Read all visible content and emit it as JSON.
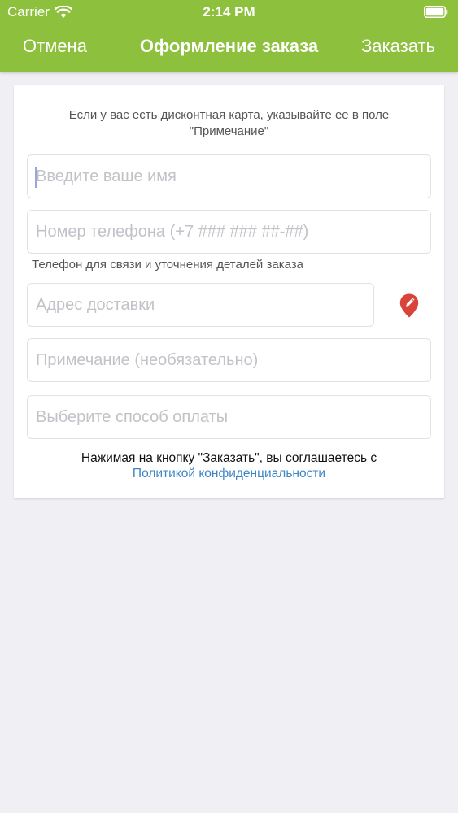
{
  "status_bar": {
    "carrier": "Carrier",
    "time": "2:14 PM",
    "wifi_icon": "wifi-icon",
    "battery_icon": "battery-icon"
  },
  "nav": {
    "cancel_label": "Отмена",
    "title": "Оформление заказа",
    "order_label": "Заказать"
  },
  "form": {
    "hint": "Если у вас есть дисконтная карта, указывайте ее в поле \"Примечание\"",
    "name_placeholder": "Введите ваше имя",
    "phone_placeholder": "Номер телефона (+7 ### ### ##-##)",
    "phone_note": "Телефон для связи и уточнения деталей заказа",
    "address_placeholder": "Адрес доставки",
    "comment_placeholder": "Примечание (необязательно)",
    "payment_placeholder": "Выберите способ оплаты",
    "agreement_text": "Нажимая на кнопку \"Заказать\", вы соглашаетесь с",
    "policy_link": "Политикой конфиденциальности",
    "location_icon": "map-pin-icon"
  },
  "colors": {
    "accent": "#8dc03c",
    "link": "#3d86c6",
    "pin": "#d9443a",
    "background": "#efeff4"
  }
}
